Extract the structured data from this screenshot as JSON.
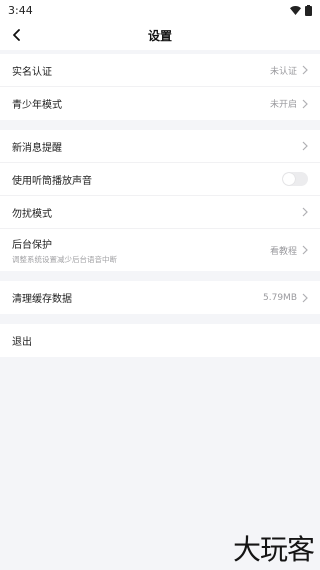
{
  "status_bar": {
    "time": "3:44",
    "wifi_icon": "wifi-icon",
    "battery_icon": "battery-icon"
  },
  "header": {
    "title": "设置",
    "back_icon": "chevron-left-icon"
  },
  "groups": [
    {
      "items": [
        {
          "label": "实名认证",
          "value": "未认证"
        },
        {
          "label": "青少年模式",
          "value": "未开启"
        }
      ]
    },
    {
      "items": [
        {
          "label": "新消息提醒",
          "value": ""
        },
        {
          "label": "使用听筒播放声音",
          "toggle": false
        },
        {
          "label": "勿扰模式",
          "value": ""
        },
        {
          "label": "后台保护",
          "sub": "调整系统设置减少后台语音中断",
          "value": "看教程"
        }
      ]
    },
    {
      "items": [
        {
          "label": "清理缓存数据",
          "value": "5.79MB"
        }
      ]
    },
    {
      "items": [
        {
          "label": "退出"
        }
      ]
    }
  ],
  "watermark": "大玩客"
}
